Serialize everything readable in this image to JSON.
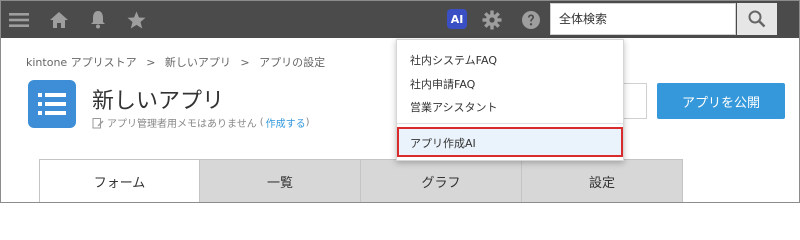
{
  "header": {
    "icons": [
      "menu-icon",
      "home-icon",
      "bell-icon",
      "star-icon",
      "ai-icon",
      "gear-icon",
      "help-icon",
      "search-icon"
    ],
    "ai_label": "AI",
    "search_placeholder": "全体検索"
  },
  "breadcrumb": {
    "items": [
      "kintone アプリストア",
      ">",
      "新しいアプリ",
      ">",
      "アプリの設定"
    ]
  },
  "app": {
    "name": "新しいアプリ",
    "memo_text": "アプリ管理者用メモはありません",
    "memo_link_open": "(",
    "memo_link": "作成する",
    "memo_link_close": ")",
    "publish_label": "アプリを公開"
  },
  "tabs": [
    "フォーム",
    "一覧",
    "グラフ",
    "設定"
  ],
  "dropdown": {
    "items": [
      "社内システムFAQ",
      "社内申請FAQ",
      "営業アシスタント"
    ],
    "highlighted_item": "アプリ作成AI"
  },
  "colors": {
    "header_bg": "#4b4b4b",
    "accent_blue": "#3498db",
    "ai_badge": "#3a4fc4",
    "highlight_border": "#d92b2b"
  }
}
